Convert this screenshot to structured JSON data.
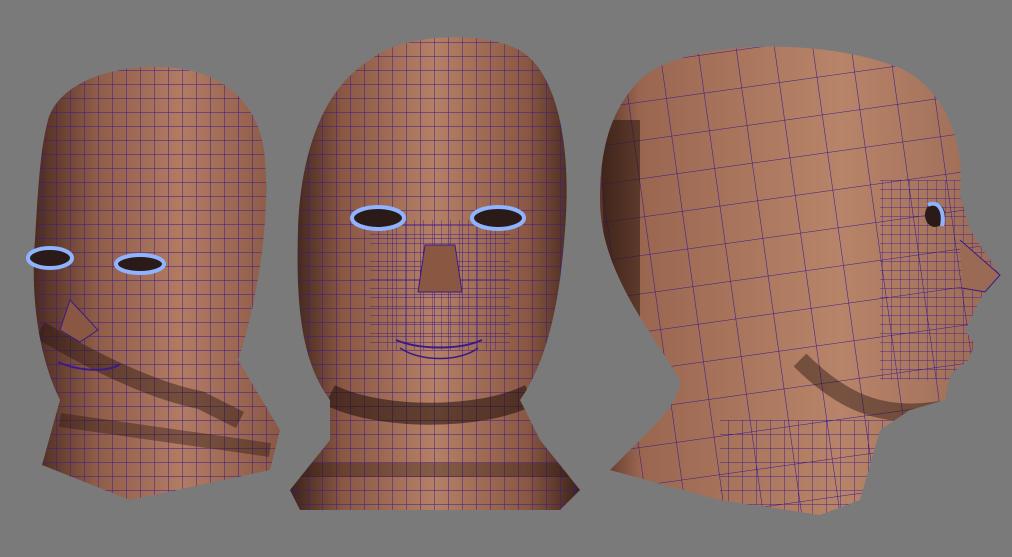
{
  "scene": {
    "background_color": "#7a7a7a",
    "skin_color": "#a8735e",
    "skin_shadow_color": "#5a3428",
    "wire_color": "#3a1a8a",
    "eye_color": "#8fb3ff",
    "views": [
      {
        "id": "three-quarter"
      },
      {
        "id": "front"
      },
      {
        "id": "side"
      }
    ]
  }
}
